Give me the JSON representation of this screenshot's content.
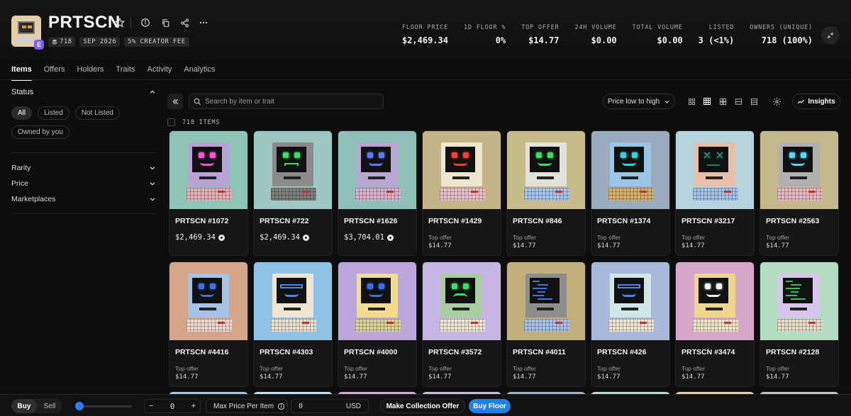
{
  "collection": {
    "title": "PRTSCN",
    "verified_badge": "E",
    "chips": [
      {
        "icon": "layers-icon",
        "text": "718"
      },
      {
        "icon": null,
        "text": "SEP 2026"
      },
      {
        "icon": null,
        "text": "5% CREATOR FEE"
      }
    ]
  },
  "stats": [
    {
      "label": "FLOOR PRICE",
      "value": "$2,469.34"
    },
    {
      "label": "1D FLOOR %",
      "value": "0%"
    },
    {
      "label": "TOP OFFER",
      "value": "$14.77"
    },
    {
      "label": "24H VOLUME",
      "value": "$0.00"
    },
    {
      "label": "TOTAL VOLUME",
      "value": "$0.00"
    },
    {
      "label": "LISTED",
      "value": "3 (<1%)"
    },
    {
      "label": "OWNERS (UNIQUE)",
      "value": "718 (100%)"
    }
  ],
  "tabs": [
    "Items",
    "Offers",
    "Holders",
    "Traits",
    "Activity",
    "Analytics"
  ],
  "active_tab": "Items",
  "sidebar": {
    "status_title": "Status",
    "status_options": [
      "All",
      "Listed",
      "Not Listed",
      "Owned by you"
    ],
    "filters": [
      "Rarity",
      "Price",
      "Marketplaces"
    ]
  },
  "toolbar": {
    "search_placeholder": "Search by item or trait",
    "sort_label": "Price low to high",
    "insights_label": "Insights",
    "items_count": "718 ITEMS"
  },
  "offer_label": "Top offer",
  "items": [
    {
      "name": "PRTSCN #1072",
      "price": "$2,469.34",
      "offer": null,
      "bg": "#8fc4b6",
      "case": "#b9a3d6",
      "kbd": "#e3b1b8",
      "face": "#ff4fd8",
      "face_type": "smile"
    },
    {
      "name": "PRTSCN #722",
      "price": "$2,469.34",
      "offer": null,
      "bg": "#9ec7c2",
      "case": "#8a8a8a",
      "kbd": "#7d7d7d",
      "face": "#35e06a",
      "face_type": "angry"
    },
    {
      "name": "PRTSCN #1626",
      "price": "$3,704.01",
      "offer": null,
      "bg": "#8fc0b8",
      "case": "#b8a5d2",
      "kbd": "#dcb0cf",
      "face": "#5a7cff",
      "face_type": "smile"
    },
    {
      "name": "PRTSCN #1429",
      "price": null,
      "offer": "$14.77",
      "bg": "#c5b487",
      "case": "#eee6cf",
      "kbd": "#e9c0c8",
      "face": "#ff3b30",
      "face_type": "smile"
    },
    {
      "name": "PRTSCN #846",
      "price": null,
      "offer": "$14.77",
      "bg": "#c8bb8c",
      "case": "#e2e2da",
      "kbd": "#a8c4ea",
      "face": "#35e06a",
      "face_type": "smile"
    },
    {
      "name": "PRTSCN #1374",
      "price": null,
      "offer": "$14.77",
      "bg": "#9aaabf",
      "case": "#9cc6e6",
      "kbd": "#d4b06a",
      "face": "#2fd3e6",
      "face_type": "smile"
    },
    {
      "name": "PRTSCN #3217",
      "price": null,
      "offer": "$14.77",
      "bg": "#b7d4de",
      "case": "#e8bfa9",
      "kbd": "#a5c2e6",
      "face": "#1e7f6a",
      "face_type": "cross"
    },
    {
      "name": "PRTSCN #2563",
      "price": null,
      "offer": "$14.77",
      "bg": "#c4b98c",
      "case": "#b0b0b0",
      "kbd": "#e6b8c2",
      "face": "#4fd8ff",
      "face_type": "smile"
    },
    {
      "name": "PRTSCN #4416",
      "price": null,
      "offer": "$14.77",
      "bg": "#d5a58a",
      "case": "#a6c3e6",
      "kbd": "#efd7cf",
      "face": "#3f6fe8",
      "face_type": "smile"
    },
    {
      "name": "PRTSCN #4303",
      "price": null,
      "offer": "$14.77",
      "bg": "#8fc2e8",
      "case": "#eee6d2",
      "kbd": "#e8e2cf",
      "face": "#4a86ff",
      "face_type": "shades"
    },
    {
      "name": "PRTSCN #4000",
      "price": null,
      "offer": "$14.77",
      "bg": "#bca7dc",
      "case": "#f2dc90",
      "kbd": "#d9d39a",
      "face": "#3f6fe8",
      "face_type": "smile"
    },
    {
      "name": "PRTSCN #3572",
      "price": null,
      "offer": "$14.77",
      "bg": "#c6b6e4",
      "case": "#a8ce9f",
      "kbd": "#eee6d2",
      "face": "#35e06a",
      "face_type": "sad"
    },
    {
      "name": "PRTSCN #4011",
      "price": null,
      "offer": "$14.77",
      "bg": "#c2b07c",
      "case": "#8d8d8d",
      "kbd": "#a7c2e6",
      "face": "#4a86ff",
      "face_type": "glitch"
    },
    {
      "name": "PRTSCN #426",
      "price": null,
      "offer": "$14.77",
      "bg": "#a8b9dc",
      "case": "#cfe7e6",
      "kbd": "#eee6d2",
      "face": "#4a86ff",
      "face_type": "shades"
    },
    {
      "name": "PRTSCN #3474",
      "price": null,
      "offer": "$14.77",
      "bg": "#d7a7c9",
      "case": "#f0d58d",
      "kbd": "#efe4c7",
      "face": "#f2f2f2",
      "face_type": "smile"
    },
    {
      "name": "PRTSCN #2128",
      "price": null,
      "offer": "$14.77",
      "bg": "#b4dcc3",
      "case": "#d9c4ee",
      "kbd": "#e5dcc9",
      "face": "#35e06a",
      "face_type": "glitch"
    }
  ],
  "peek_colors": [
    "#9fc7ea",
    "#bfe0f0",
    "#d7a7d9",
    "#c9b9e6",
    "#a3b3c6",
    "#b8d8d2",
    "#e8c8a8",
    "#c2c2c2"
  ],
  "bottombar": {
    "buy_label": "Buy",
    "sell_label": "Sell",
    "quantity": "0",
    "minus": "−",
    "plus": "+",
    "max_price_label": "Max Price Per Item",
    "price_value": "0",
    "currency": "USD",
    "make_offer_label": "Make Collection Offer",
    "buy_floor_label": "Buy Floor"
  }
}
